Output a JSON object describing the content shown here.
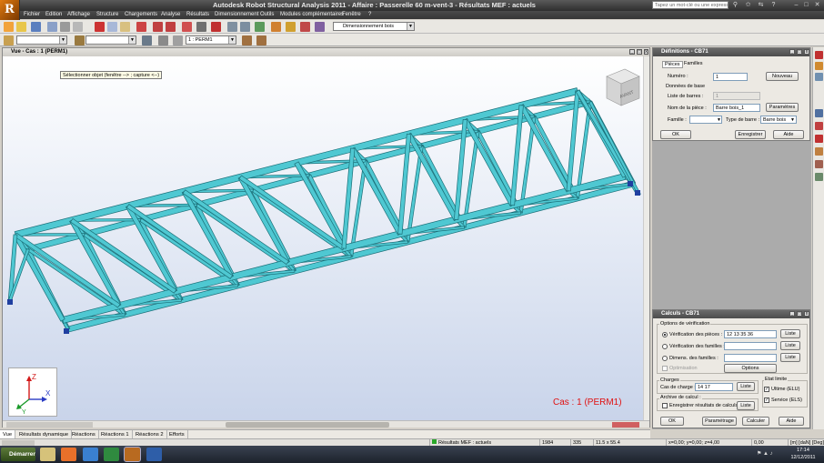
{
  "window": {
    "title": "Autodesk Robot Structural Analysis 2011 - Affaire : Passerelle 60 m-vent-3 - Résultats MEF : actuels",
    "search_placeholder": "Tapez un mot-clé ou une expressi"
  },
  "menu": [
    "Fichier",
    "Edition",
    "Affichage",
    "Structure",
    "Chargements",
    "Analyse",
    "Résultats",
    "Dimensionnement",
    "Outils",
    "Modules complémentaires",
    "Fenêtre",
    "?"
  ],
  "toolbar": {
    "dimension_dropdown": "Dimensionnement bois",
    "case_dropdown": "1 : PERM1"
  },
  "viewport": {
    "title": "Vue - Cas : 1 (PERM1)",
    "tooltip": "Sélectionner objet (fenêtre --> ; capture <--)",
    "case_label": "Cas : 1 (PERM1)",
    "viewcube_label": "AVANT",
    "axes": {
      "x": "X",
      "y": "Y",
      "z": "Z"
    }
  },
  "definitions_dialog": {
    "title": "Définitions - CB71",
    "tabs": [
      "Pièces",
      "Familles"
    ],
    "numero_label": "Numéro :",
    "numero_value": "1",
    "nouveau_button": "Nouveau",
    "donnees_label": "Données de base",
    "liste_barres_label": "Liste de barres :",
    "liste_barres_value": "1",
    "nom_piece_label": "Nom de la pièce :",
    "nom_piece_value": "Barre bois_1",
    "parametres_button": "Paramètres",
    "famille_label": "Famille :",
    "type_barre_label": "Type de barre :",
    "type_barre_value": "Barre bois",
    "ok_button": "OK",
    "enregistrer_button": "Enregistrer",
    "aide_button": "Aide"
  },
  "calculs_dialog": {
    "title": "Calculs - CB71",
    "options_label": "Options de vérification",
    "verif_pieces_label": "Vérification des pièces :",
    "verif_pieces_value": "12 13 35 36",
    "verif_familles_label": "Vérification des familles :",
    "dimens_familles_label": "Dimens. des familles :",
    "optimisation_label": "Optimisation",
    "liste_button": "Liste",
    "options_button": "Options",
    "charges_label": "Charges",
    "cas_charge_label": "Cas de charge :",
    "cas_charge_value": "14 17",
    "etat_limite_label": "Etat limite",
    "ultime_label": "Ultime (ELU)",
    "service_label": "Service (ELS)",
    "archive_label": "Archive de calcul :",
    "enregistrer_label": "Enregistrer résultats de calculs",
    "ok_button": "OK",
    "parametrage_button": "Paramétrage",
    "calculer_button": "Calculer",
    "aide_button": "Aide"
  },
  "bottom_tabs": [
    "Vue",
    "Résultats dynamique",
    "Réactions",
    "Réactions 1",
    "Réactions 2",
    "Efforts"
  ],
  "status": {
    "results": "Résultats MEF : actuels",
    "nodes": "1984",
    "bars": "335",
    "section": "11.5 x 55.4",
    "coords": "x=0,00; y=0,00; z=4,00",
    "value": "0,00",
    "units": "[m] [daN] [Deg]"
  },
  "taskbar": {
    "start": "Démarrer",
    "time": "17:14",
    "date": "12/12/2011"
  },
  "colors": {
    "structure_fill": "#4fc8d2",
    "structure_edge": "#1b6f78",
    "case_label": "#e01010"
  }
}
